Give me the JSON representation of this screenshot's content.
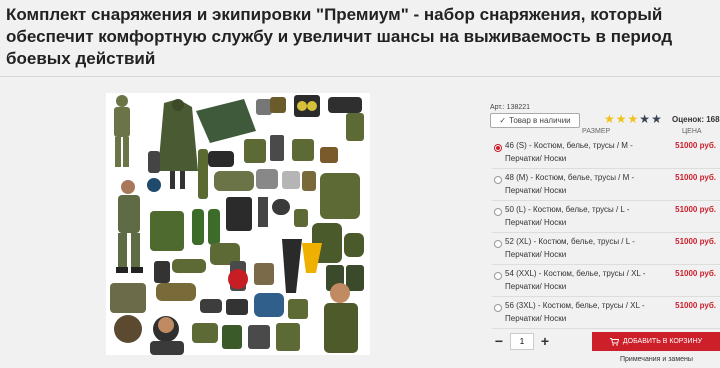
{
  "product": {
    "title": "Комплект снаряжения и экипировки \"Премиум\" - набор снаряжения, который обеспечит комфортную службу и увеличит шансы на выживаемость в период боевых действий",
    "sku": "Арт.: 138221",
    "stock_label": "Товар в наличии",
    "rating": {
      "filled": 3,
      "total": 5,
      "label": "Оценок: 168"
    }
  },
  "columns": {
    "size": "РАЗМЕР",
    "price": "ЦЕНА"
  },
  "options": [
    {
      "label": "46 (S) - Костюм, белье, трусы / М - Перчатки/ Носки",
      "price": "51000 руб.",
      "selected": true
    },
    {
      "label": "48 (M) - Костюм, белье, трусы / М - Перчатки/ Носки",
      "price": "51000 руб.",
      "selected": false
    },
    {
      "label": "50 (L) - Костюм, белье, трусы / L - Перчатки/ Носки",
      "price": "51000 руб.",
      "selected": false
    },
    {
      "label": "52 (XL) - Костюм, белье, трусы / L - Перчатки/ Носки",
      "price": "51000 руб.",
      "selected": false
    },
    {
      "label": "54 (XXL) - Костюм, белье, трусы / XL - Перчатки/ Носки",
      "price": "51000 руб.",
      "selected": false
    },
    {
      "label": "56 (3XL) - Костюм, белье, трусы / XL - Перчатки/ Носки",
      "price": "51000 руб.",
      "selected": false
    }
  ],
  "quantity": {
    "minus": "−",
    "value": "1",
    "plus": "+"
  },
  "cart": {
    "label": "ДОБАВИТЬ В КОРЗИНУ",
    "icon": "cart-icon"
  },
  "notes_link": "Примечания и замены",
  "colors": {
    "accent": "#cc1f2a",
    "star": "#f2c21a",
    "star_empty": "#3b4453"
  }
}
